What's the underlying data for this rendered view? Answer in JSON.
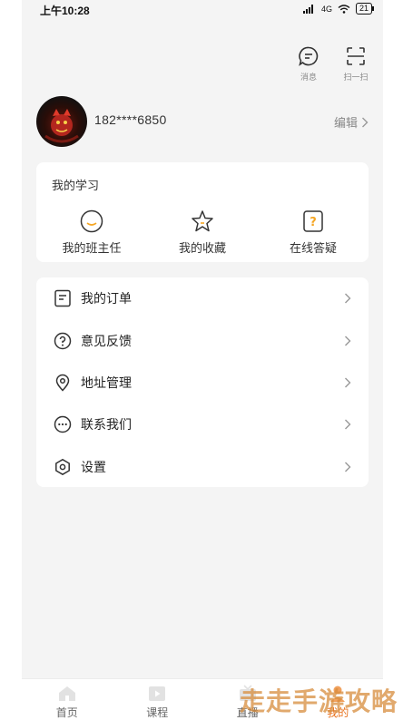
{
  "status_bar": {
    "time": "上午10:28",
    "network": "4G",
    "battery": "21"
  },
  "header": {
    "message_label": "消息",
    "scan_label": "扫一扫"
  },
  "profile": {
    "phone": "182****6850",
    "edit_label": "编辑"
  },
  "study": {
    "title": "我的学习",
    "items": [
      {
        "label": "我的班主任",
        "icon": "smile-icon"
      },
      {
        "label": "我的收藏",
        "icon": "star-icon"
      },
      {
        "label": "在线答疑",
        "icon": "question-doc-icon"
      }
    ]
  },
  "menu": {
    "items": [
      {
        "label": "我的订单",
        "icon": "order-icon"
      },
      {
        "label": "意见反馈",
        "icon": "help-circle-icon"
      },
      {
        "label": "地址管理",
        "icon": "location-icon"
      },
      {
        "label": "联系我们",
        "icon": "chat-dots-icon"
      },
      {
        "label": "设置",
        "icon": "settings-icon"
      }
    ]
  },
  "tabs": [
    {
      "label": "首页",
      "icon": "home-icon",
      "active": false
    },
    {
      "label": "课程",
      "icon": "course-icon",
      "active": false
    },
    {
      "label": "直播",
      "icon": "live-icon",
      "active": false
    },
    {
      "label": "我的",
      "icon": "profile-icon",
      "active": true
    }
  ],
  "watermark": "走走手游攻略",
  "colors": {
    "accent": "#e8711c",
    "background": "#f4f4f4",
    "card": "#ffffff",
    "star_accent": "#f5a623"
  }
}
